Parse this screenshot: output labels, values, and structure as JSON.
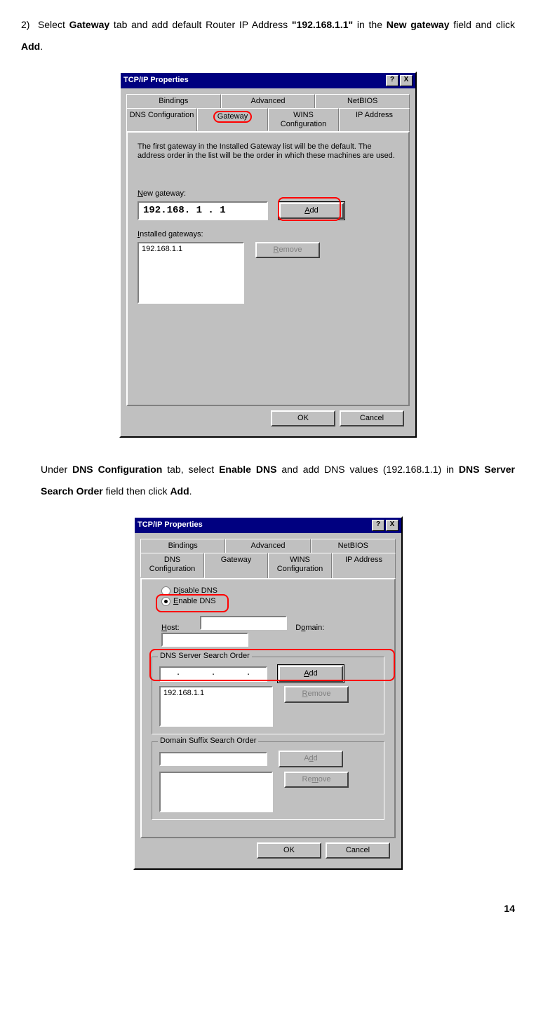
{
  "step2": {
    "num": "2)",
    "text_a": "Select ",
    "b1": "Gateway",
    "text_b": " tab and add default Router IP Address ",
    "b2": "\"192.168.1.1\"",
    "text_c": " in the ",
    "b3": "New gateway",
    "text_d": " field and click ",
    "b4": "Add",
    "text_e": "."
  },
  "dialog1": {
    "title": "TCP/IP Properties",
    "help": "?",
    "close": "X",
    "tabs_row1": {
      "t1": "Bindings",
      "t2": "Advanced",
      "t3": "NetBIOS"
    },
    "tabs_row2": {
      "t1": "DNS Configuration",
      "t2": "Gateway",
      "t3": "WINS Configuration",
      "t4": "IP Address"
    },
    "desc": "The first gateway in the Installed Gateway list will be the default. The address order in the list will be the order in which these machines are used.",
    "new_gateway_label": "New gateway:",
    "new_gateway_value": "192.168. 1 . 1",
    "add_label": "Add",
    "installed_label": "Installed gateways:",
    "installed_value": "192.168.1.1",
    "remove_label": "Remove",
    "ok": "OK",
    "cancel": "Cancel"
  },
  "mid_text": {
    "a": "Under ",
    "b1": "DNS Configuration",
    "b": " tab, select ",
    "b2": "Enable DNS",
    "c": " and add DNS values (192.168.1.1) in ",
    "b3": "DNS Server Search Order",
    "d": " field then click ",
    "b4": "Add",
    "e": "."
  },
  "dialog2": {
    "title": "TCP/IP Properties",
    "help": "?",
    "close": "X",
    "tabs_row1": {
      "t1": "Bindings",
      "t2": "Advanced",
      "t3": "NetBIOS"
    },
    "tabs_row2": {
      "t1": "DNS Configuration",
      "t2": "Gateway",
      "t3": "WINS Configuration",
      "t4": "IP Address"
    },
    "disable_dns": "Disable DNS",
    "enable_dns": "Enable DNS",
    "host_label": "Host:",
    "domain_label": "Domain:",
    "dns_order_label": "DNS Server Search Order",
    "ip_dots": ". . .",
    "add_label": "Add",
    "dns_value": "192.168.1.1",
    "remove_label": "Remove",
    "suffix_label": "Domain Suffix Search Order",
    "add2": "Add",
    "remove2": "Remove",
    "ok": "OK",
    "cancel": "Cancel"
  },
  "page_number": "14"
}
